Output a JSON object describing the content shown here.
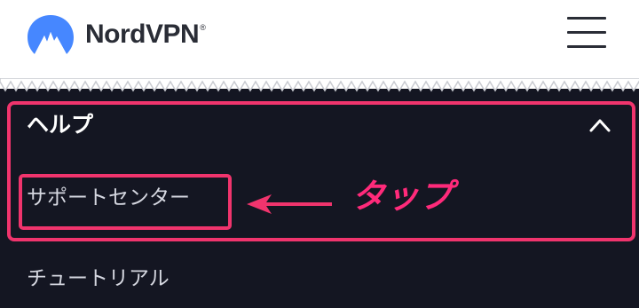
{
  "header": {
    "logo_text": "NordVPN",
    "logo_mark": "®",
    "menu_icon": "hamburger-menu-icon"
  },
  "help_section": {
    "title": "ヘルプ",
    "expanded_icon": "chevron-up-icon",
    "items": [
      {
        "label": "サポートセンター"
      }
    ]
  },
  "other_items": [
    {
      "label": "チュートリアル"
    }
  ],
  "annotation": {
    "label": "タップ",
    "color": "#f0346d",
    "arrow_icon": "left-arrow-icon"
  },
  "colors": {
    "background": "#141622",
    "header_background": "#ffffff",
    "brand_blue": "#4687ff",
    "highlight": "#f0346d"
  }
}
